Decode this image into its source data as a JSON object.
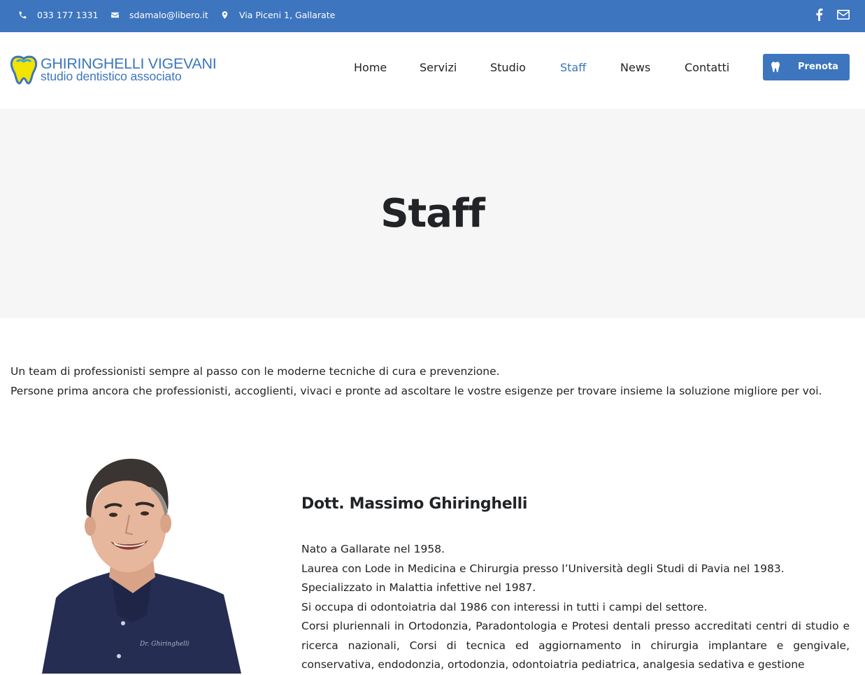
{
  "topbar": {
    "phone": "033 177 1331",
    "email": "sdamalo@libero.it",
    "address": "Via Piceni 1, Gallarate",
    "social_icons": [
      "facebook-icon",
      "email-icon"
    ]
  },
  "logo": {
    "title": "GHIRINGHELLI VIGEVANI",
    "subtitle": "studio dentistico associato"
  },
  "nav": {
    "items": [
      {
        "label": "Home"
      },
      {
        "label": "Servizi"
      },
      {
        "label": "Studio"
      },
      {
        "label": "Staff",
        "active": true
      },
      {
        "label": "News"
      },
      {
        "label": "Contatti"
      }
    ],
    "cta_label": "Prenota"
  },
  "page": {
    "title": "Staff",
    "intro": [
      "Un team di professionisti sempre al passo con le moderne tecniche di cura e prevenzione.",
      "Persone prima ancora che professionisti, accoglienti, vivaci e pronte ad ascoltare le vostre esigenze per trovare insieme la soluzione migliore per voi."
    ]
  },
  "staff": [
    {
      "name": "Dott. Massimo Ghiringhelli",
      "bio": [
        "Nato a Gallarate nel 1958.",
        "Laurea con Lode in Medicina e Chirurgia presso l’Università degli Studi di Pavia nel 1983.",
        "Specializzato in Malattia infettive nel 1987.",
        "Si occupa di odontoiatria dal 1986 con interessi in tutti i campi del settore.",
        "Corsi pluriennali in Ortodonzia, Paradontologia e Protesi dentali presso accreditati centri di studio e ricerca nazionali, Corsi di tecnica ed aggiornamento in chirurgia implantare e gengivale, conservativa, endodonzia, ortodonzia, odontoiatria pediatrica, analgesia sedativa e gestione"
      ]
    }
  ],
  "colors": {
    "brand_blue": "#3d75be",
    "logo_yellow": "#f3e300",
    "title_bg": "#f6f6f7",
    "text": "#212326"
  }
}
